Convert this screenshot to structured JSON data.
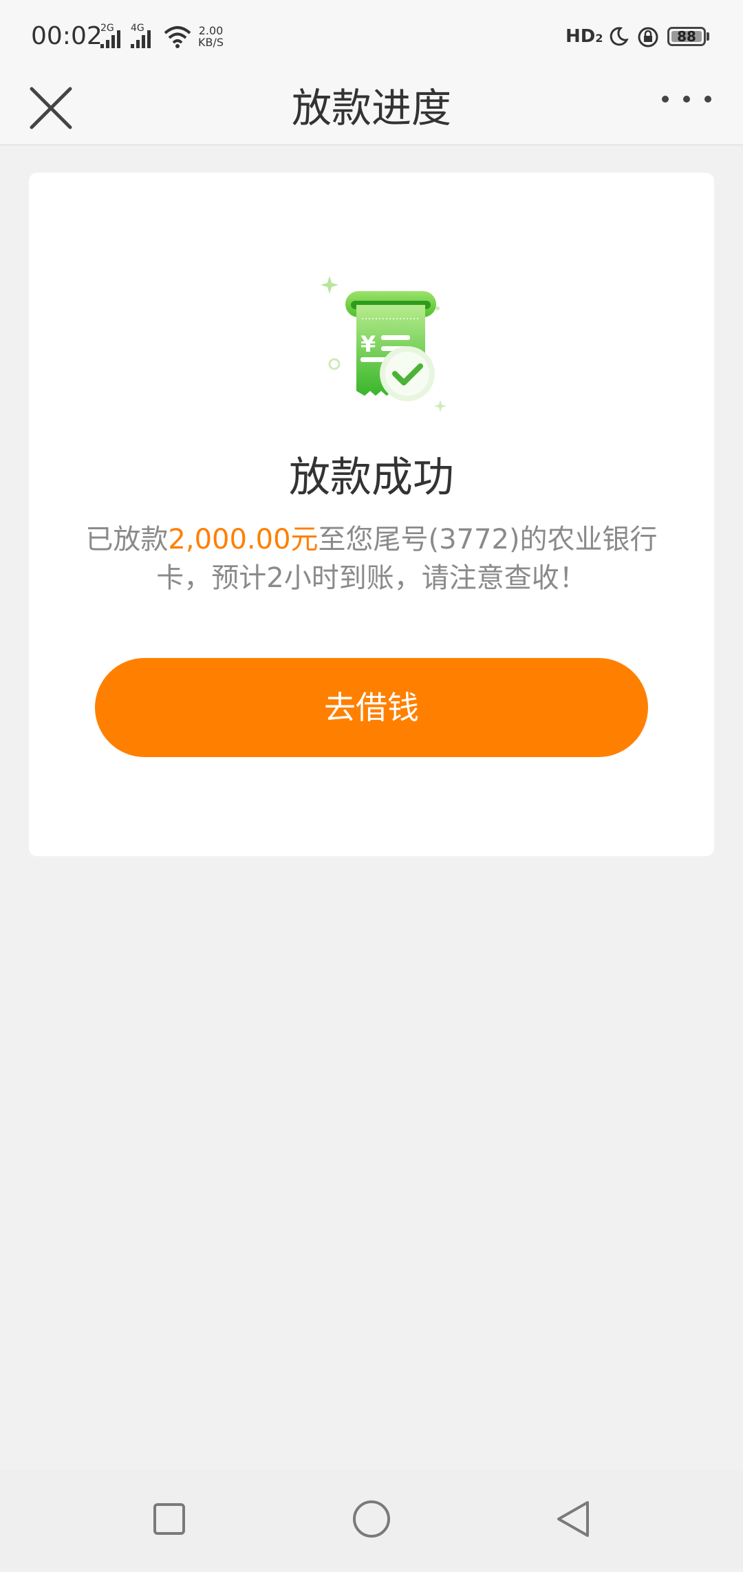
{
  "status_bar": {
    "time": "00:02",
    "signal1_label": "2G",
    "signal2_label": "4G",
    "speed_value": "2.00",
    "speed_unit": "KB/S",
    "hd_label": "HD",
    "hd_sub": "2",
    "battery": "88"
  },
  "header": {
    "title": "放款进度",
    "close_icon": "close-icon",
    "more_icon": "more-icon"
  },
  "result": {
    "icon": "receipt-success-icon",
    "title": "放款成功",
    "desc_prefix": "已放款",
    "amount": "2,000.00元",
    "desc_suffix": "至您尾号(3772)的农业银行卡，预计2小时到账，请注意查收！",
    "button_label": "去借钱"
  },
  "nav_bar": {
    "recent_icon": "square-icon",
    "home_icon": "circle-icon",
    "back_icon": "triangle-back-icon"
  },
  "colors": {
    "accent": "#ff8000",
    "green": "#5cc234",
    "background": "#f1f1f1"
  }
}
